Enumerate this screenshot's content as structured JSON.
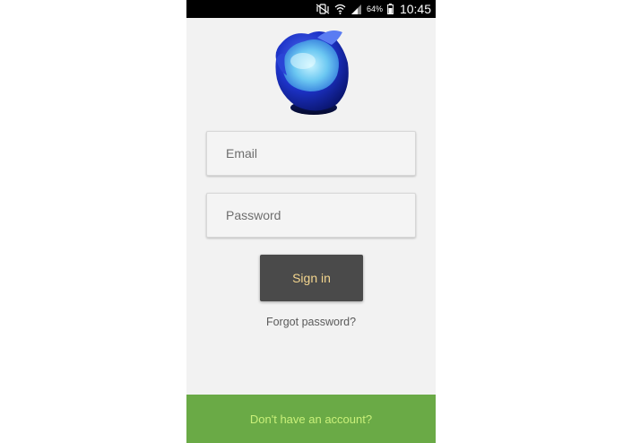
{
  "status_bar": {
    "battery_percent": "64%",
    "time": "10:45",
    "icons": [
      "mute-vibrate-icon",
      "wifi-icon",
      "signal-icon",
      "battery-icon"
    ]
  },
  "logo": {
    "icon": "blue-bowl-logo-icon"
  },
  "login_form": {
    "email_placeholder": "Email",
    "email_value": "",
    "password_placeholder": "Password",
    "password_value": "",
    "signin_label": "Sign in",
    "forgot_label": "Forgot password?"
  },
  "footer": {
    "signup_label": "Don't have an account?"
  },
  "colors": {
    "background": "#f2f2f2",
    "status_bar": "#000000",
    "button_bg": "#4a4a4a",
    "button_text": "#f3d58e",
    "footer_bg": "#6aaa46",
    "footer_text": "#c9f07a"
  }
}
